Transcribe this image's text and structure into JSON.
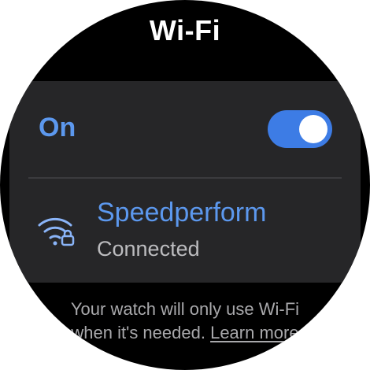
{
  "header": {
    "title": "Wi-Fi"
  },
  "wifi_toggle": {
    "label": "On",
    "enabled": true
  },
  "network": {
    "name": "Speedperform",
    "status": "Connected",
    "icon": "wifi-lock-icon"
  },
  "footer": {
    "text_line1": "Your watch will only use Wi-Fi",
    "text_line2": "when it's needed.",
    "learn_more": "Learn more"
  },
  "colors": {
    "accent": "#5c98ee",
    "switch_track": "#3d7ce5",
    "card_background": "#262628",
    "background": "#000000"
  }
}
